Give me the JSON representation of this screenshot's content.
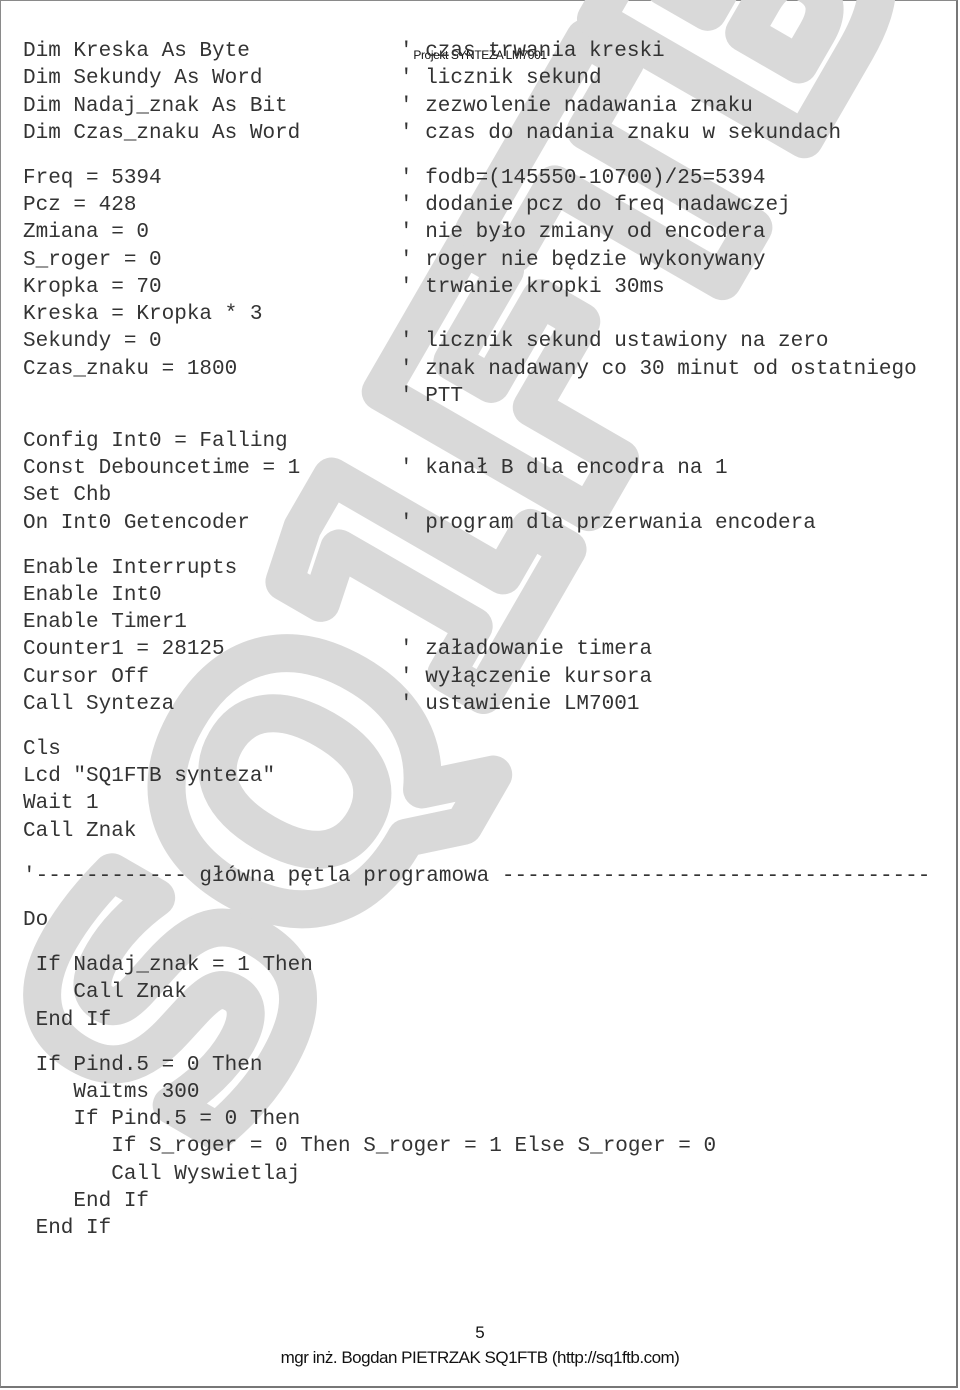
{
  "header": {
    "title": "Projekt SYNTEZA LM7001"
  },
  "watermark": {
    "text": "SQ1FTB",
    "color": "#d9d9d9"
  },
  "code": {
    "blocks": [
      [
        {
          "stmt": "Dim Kreska As Byte",
          "cmt": "' czas trwania kreski"
        },
        {
          "stmt": "Dim Sekundy As Word",
          "cmt": "' licznik sekund"
        },
        {
          "stmt": "Dim Nadaj_znak As Bit",
          "cmt": "' zezwolenie nadawania znaku"
        },
        {
          "stmt": "Dim Czas_znaku As Word",
          "cmt": "' czas do nadania znaku w sekundach"
        }
      ],
      [
        {
          "stmt": "Freq = 5394",
          "cmt": "' fodb=(145550-10700)/25=5394"
        },
        {
          "stmt": "Pcz = 428",
          "cmt": "' dodanie pcz do freq nadawczej"
        },
        {
          "stmt": "Zmiana = 0",
          "cmt": "' nie było zmiany od encodera"
        },
        {
          "stmt": "S_roger = 0",
          "cmt": "' roger nie będzie wykonywany"
        },
        {
          "stmt": "Kropka = 70",
          "cmt": "' trwanie kropki 30ms"
        },
        {
          "stmt": "Kreska = Kropka * 3",
          "cmt": ""
        },
        {
          "stmt": "Sekundy = 0",
          "cmt": "' licznik sekund ustawiony na zero"
        },
        {
          "stmt": "Czas_znaku = 1800",
          "cmt": "' znak nadawany co 30 minut od ostatniego"
        },
        {
          "stmt": "",
          "cmt": "' PTT"
        }
      ],
      [
        {
          "stmt": "Config Int0 = Falling",
          "cmt": ""
        },
        {
          "stmt": "Const Debouncetime = 1",
          "cmt": "' kanał B dla encodra na 1"
        },
        {
          "stmt": "Set Chb",
          "cmt": ""
        },
        {
          "stmt": "On Int0 Getencoder",
          "cmt": "' program dla przerwania encodera"
        }
      ],
      [
        {
          "stmt": "Enable Interrupts",
          "cmt": ""
        },
        {
          "stmt": "Enable Int0",
          "cmt": ""
        },
        {
          "stmt": "Enable Timer1",
          "cmt": ""
        },
        {
          "stmt": "Counter1 = 28125",
          "cmt": "' załadowanie timera"
        },
        {
          "stmt": "Cursor Off",
          "cmt": "' wyłączenie kursora"
        },
        {
          "stmt": "Call Synteza",
          "cmt": "' ustawienie LM7001"
        }
      ],
      [
        {
          "stmt": "Cls",
          "cmt": ""
        },
        {
          "stmt": "Lcd \"SQ1FTB synteza\"",
          "cmt": ""
        },
        {
          "stmt": "Wait 1",
          "cmt": ""
        },
        {
          "stmt": "Call Znak",
          "cmt": ""
        }
      ],
      [
        {
          "stmt": "'------------ główna pętla programowa ----------------------------------",
          "cmt": ""
        }
      ],
      [
        {
          "stmt": "Do",
          "cmt": ""
        }
      ],
      [
        {
          "stmt": " If Nadaj_znak = 1 Then",
          "cmt": ""
        },
        {
          "stmt": "    Call Znak",
          "cmt": ""
        },
        {
          "stmt": " End If",
          "cmt": ""
        }
      ],
      [
        {
          "stmt": " If Pind.5 = 0 Then",
          "cmt": ""
        },
        {
          "stmt": "    Waitms 300",
          "cmt": ""
        },
        {
          "stmt": "    If Pind.5 = 0 Then",
          "cmt": ""
        },
        {
          "stmt": "       If S_roger = 0 Then S_roger = 1 Else S_roger = 0",
          "cmt": ""
        },
        {
          "stmt": "       Call Wyswietlaj",
          "cmt": ""
        },
        {
          "stmt": "    End If",
          "cmt": ""
        },
        {
          "stmt": " End If",
          "cmt": ""
        }
      ]
    ]
  },
  "footer": {
    "page_number": "5",
    "author": "mgr inż. Bogdan PIETRZAK SQ1FTB (http://sq1ftb.com)"
  }
}
